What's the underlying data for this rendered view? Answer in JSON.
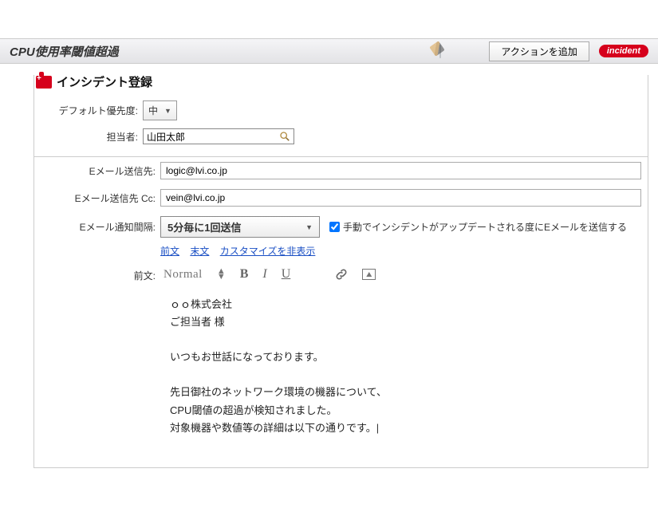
{
  "header": {
    "title": "CPU使用率閾値超過",
    "add_action_label": "アクションを追加",
    "badge_text": "incident"
  },
  "section": {
    "title": "インシデント登録"
  },
  "defaults": {
    "priority_label": "デフォルト優先度:",
    "priority_value": "中",
    "assignee_label": "担当者:",
    "assignee_value": "山田太郎"
  },
  "mail": {
    "to_label": "Eメール送信先:",
    "to_value": "logic@lvi.co.jp",
    "cc_label": "Eメール送信先 Cc:",
    "cc_value": "vein@lvi.co.jp",
    "interval_label": "Eメール通知間隔:",
    "interval_value": "5分毎に1回送信",
    "manual_checkbox_label": "手動でインシデントがアップデートされる度にEメールを送信する",
    "manual_checked": true
  },
  "links": {
    "prefix": "前文",
    "suffix": "末文",
    "hide_customize": "カスタマイズを非表示"
  },
  "editor": {
    "prefix_label": "前文:",
    "font_style": "Normal",
    "body_lines": [
      "ｏｏ株式会社",
      "ご担当者 様",
      "",
      "いつもお世話になっております。",
      "",
      "先日御社のネットワーク環境の機器について、",
      "CPU閾値の超過が検知されました。",
      "対象機器や数値等の詳細は以下の通りです。"
    ]
  }
}
